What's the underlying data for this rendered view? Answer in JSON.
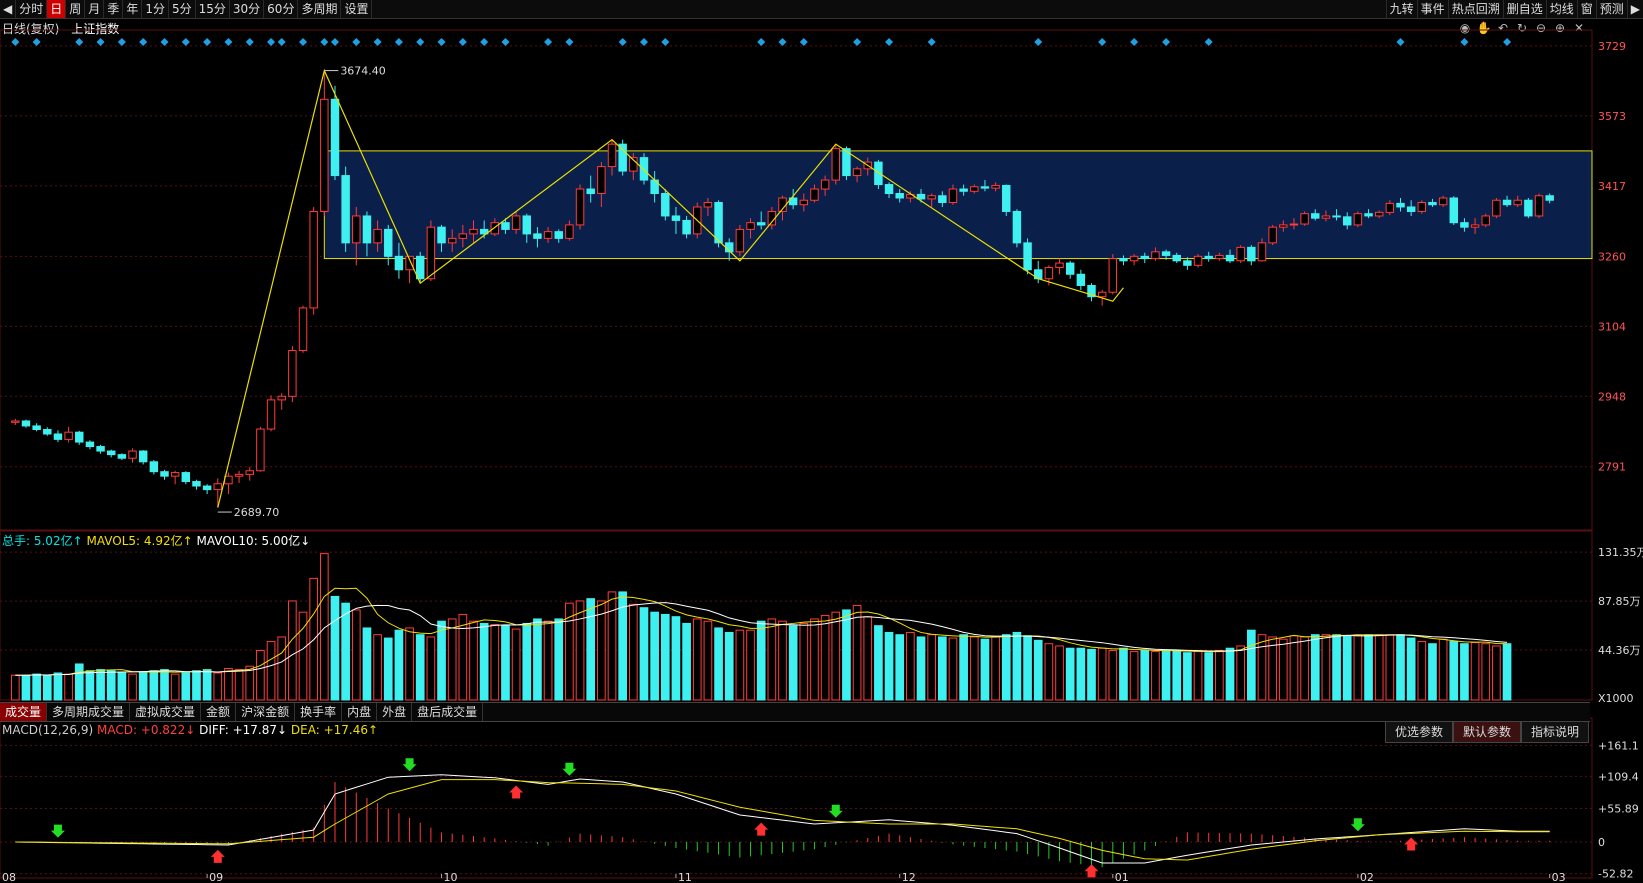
{
  "toolbar": {
    "left_items": [
      "分时",
      "日",
      "周",
      "月",
      "季",
      "年",
      "1分",
      "5分",
      "15分",
      "30分",
      "60分",
      "多周期",
      "设置"
    ],
    "active_index": 1,
    "right_items": [
      "九转",
      "事件",
      "热点回溯",
      "删自选",
      "均线",
      "窗",
      "预测"
    ]
  },
  "header": {
    "period": "日线(复权)",
    "index_name": "上证指数"
  },
  "price_axis": {
    "labels": [
      "3729",
      "3573",
      "3417",
      "3260",
      "3104",
      "2948",
      "2791"
    ]
  },
  "annotations": {
    "high_label": "3674.40",
    "low_label": "2689.70"
  },
  "volume": {
    "legend": [
      {
        "text": "总手: 5.02亿↑",
        "color": "#00e5e5"
      },
      {
        "text": "MAVOL5: 4.92亿↑",
        "color": "#f0e000"
      },
      {
        "text": "MAVOL10: 5.00亿↓",
        "color": "#ffffff"
      }
    ],
    "axis_labels": [
      "131.35万",
      "87.85万",
      "44.36万",
      "X1000"
    ]
  },
  "indicator_tabs": [
    "成交量",
    "多周期成交量",
    "虚拟成交量",
    "金额",
    "沪深金额",
    "换手率",
    "内盘",
    "外盘",
    "盘后成交量"
  ],
  "macd": {
    "legend": [
      {
        "text": "MACD(12,26,9)",
        "color": "#cccccc"
      },
      {
        "text": "MACD: +0.822↓",
        "color": "#ff4040"
      },
      {
        "text": "DIFF: +17.87↓",
        "color": "#ffffff"
      },
      {
        "text": "DEA: +17.46↑",
        "color": "#f0e000"
      }
    ],
    "axis_labels": [
      "+161.1",
      "+109.4",
      "+55.89",
      "0",
      "-52.82"
    ],
    "param_buttons": [
      "优选参数",
      "默认参数",
      "指标说明"
    ]
  },
  "date_axis": [
    "08",
    "09",
    "10",
    "11",
    "12",
    "01",
    "02",
    "03"
  ],
  "colors": {
    "up": "#ff3b3b",
    "down": "#3ff0f0",
    "box": "#0a1f4a",
    "line": "#e8e000"
  },
  "chart_data": {
    "type": "candlestick",
    "title": "上证指数",
    "price_range": [
      2650,
      3760
    ],
    "candles": [
      [
        2890,
        2898,
        2884,
        2893
      ],
      [
        2893,
        2896,
        2878,
        2882
      ],
      [
        2882,
        2888,
        2870,
        2874
      ],
      [
        2874,
        2879,
        2860,
        2864
      ],
      [
        2864,
        2872,
        2846,
        2852
      ],
      [
        2852,
        2880,
        2845,
        2868
      ],
      [
        2868,
        2871,
        2840,
        2846
      ],
      [
        2846,
        2850,
        2830,
        2836
      ],
      [
        2836,
        2840,
        2820,
        2826
      ],
      [
        2826,
        2829,
        2812,
        2818
      ],
      [
        2818,
        2821,
        2806,
        2810
      ],
      [
        2810,
        2832,
        2800,
        2826
      ],
      [
        2826,
        2828,
        2796,
        2802
      ],
      [
        2802,
        2806,
        2774,
        2780
      ],
      [
        2780,
        2784,
        2762,
        2770
      ],
      [
        2770,
        2782,
        2752,
        2778
      ],
      [
        2778,
        2781,
        2752,
        2758
      ],
      [
        2758,
        2762,
        2740,
        2748
      ],
      [
        2748,
        2752,
        2730,
        2740
      ],
      [
        2740,
        2765,
        2700,
        2753
      ],
      [
        2753,
        2778,
        2730,
        2770
      ],
      [
        2770,
        2782,
        2755,
        2774
      ],
      [
        2774,
        2790,
        2760,
        2782
      ],
      [
        2782,
        2880,
        2780,
        2875
      ],
      [
        2875,
        2950,
        2870,
        2940
      ],
      [
        2940,
        2955,
        2918,
        2948
      ],
      [
        2948,
        3060,
        2935,
        3050
      ],
      [
        3050,
        3150,
        3045,
        3145
      ],
      [
        3145,
        3370,
        3130,
        3360
      ],
      [
        3360,
        3674,
        3350,
        3610
      ],
      [
        3610,
        3640,
        3430,
        3440
      ],
      [
        3440,
        3460,
        3270,
        3290
      ],
      [
        3290,
        3370,
        3240,
        3350
      ],
      [
        3350,
        3360,
        3260,
        3290
      ],
      [
        3290,
        3340,
        3270,
        3320
      ],
      [
        3320,
        3330,
        3240,
        3260
      ],
      [
        3260,
        3290,
        3210,
        3230
      ],
      [
        3230,
        3260,
        3200,
        3260
      ],
      [
        3260,
        3270,
        3200,
        3210
      ],
      [
        3210,
        3340,
        3205,
        3325
      ],
      [
        3325,
        3330,
        3270,
        3290
      ],
      [
        3290,
        3320,
        3270,
        3300
      ],
      [
        3300,
        3330,
        3280,
        3310
      ],
      [
        3310,
        3340,
        3290,
        3320
      ],
      [
        3320,
        3340,
        3300,
        3310
      ],
      [
        3310,
        3345,
        3305,
        3335
      ],
      [
        3335,
        3345,
        3310,
        3320
      ],
      [
        3320,
        3360,
        3310,
        3350
      ],
      [
        3350,
        3355,
        3290,
        3310
      ],
      [
        3310,
        3325,
        3280,
        3300
      ],
      [
        3300,
        3325,
        3290,
        3315
      ],
      [
        3315,
        3320,
        3290,
        3300
      ],
      [
        3300,
        3340,
        3295,
        3330
      ],
      [
        3330,
        3420,
        3320,
        3410
      ],
      [
        3410,
        3440,
        3380,
        3400
      ],
      [
        3400,
        3470,
        3370,
        3460
      ],
      [
        3460,
        3520,
        3440,
        3510
      ],
      [
        3510,
        3520,
        3440,
        3450
      ],
      [
        3450,
        3490,
        3430,
        3480
      ],
      [
        3480,
        3490,
        3420,
        3430
      ],
      [
        3430,
        3450,
        3380,
        3400
      ],
      [
        3400,
        3410,
        3340,
        3350
      ],
      [
        3350,
        3370,
        3310,
        3340
      ],
      [
        3340,
        3350,
        3300,
        3310
      ],
      [
        3310,
        3380,
        3300,
        3370
      ],
      [
        3370,
        3390,
        3350,
        3380
      ],
      [
        3380,
        3385,
        3280,
        3290
      ],
      [
        3290,
        3300,
        3250,
        3270
      ],
      [
        3270,
        3330,
        3260,
        3320
      ],
      [
        3320,
        3345,
        3300,
        3335
      ],
      [
        3335,
        3360,
        3320,
        3330
      ],
      [
        3330,
        3370,
        3320,
        3360
      ],
      [
        3360,
        3395,
        3340,
        3390
      ],
      [
        3390,
        3410,
        3365,
        3375
      ],
      [
        3375,
        3400,
        3360,
        3385
      ],
      [
        3385,
        3420,
        3380,
        3410
      ],
      [
        3410,
        3440,
        3395,
        3430
      ],
      [
        3430,
        3510,
        3420,
        3500
      ],
      [
        3500,
        3505,
        3430,
        3440
      ],
      [
        3440,
        3460,
        3425,
        3455
      ],
      [
        3455,
        3480,
        3440,
        3470
      ],
      [
        3470,
        3475,
        3410,
        3420
      ],
      [
        3420,
        3425,
        3390,
        3400
      ],
      [
        3400,
        3410,
        3380,
        3390
      ],
      [
        3390,
        3405,
        3380,
        3398
      ],
      [
        3398,
        3410,
        3380,
        3388
      ],
      [
        3388,
        3400,
        3370,
        3395
      ],
      [
        3395,
        3405,
        3370,
        3380
      ],
      [
        3380,
        3420,
        3375,
        3410
      ],
      [
        3410,
        3420,
        3395,
        3405
      ],
      [
        3405,
        3420,
        3400,
        3415
      ],
      [
        3415,
        3430,
        3405,
        3412
      ],
      [
        3412,
        3425,
        3405,
        3418
      ],
      [
        3418,
        3420,
        3350,
        3360
      ],
      [
        3360,
        3365,
        3280,
        3290
      ],
      [
        3290,
        3300,
        3220,
        3230
      ],
      [
        3230,
        3250,
        3200,
        3210
      ],
      [
        3210,
        3240,
        3195,
        3235
      ],
      [
        3235,
        3255,
        3220,
        3245
      ],
      [
        3245,
        3250,
        3210,
        3220
      ],
      [
        3220,
        3230,
        3185,
        3195
      ],
      [
        3195,
        3200,
        3160,
        3170
      ],
      [
        3170,
        3185,
        3150,
        3180
      ],
      [
        3180,
        3265,
        3175,
        3255
      ],
      [
        3255,
        3262,
        3240,
        3250
      ],
      [
        3250,
        3265,
        3240,
        3260
      ],
      [
        3260,
        3268,
        3245,
        3255
      ],
      [
        3255,
        3280,
        3250,
        3270
      ],
      [
        3270,
        3275,
        3252,
        3262
      ],
      [
        3262,
        3268,
        3245,
        3250
      ],
      [
        3250,
        3258,
        3230,
        3240
      ],
      [
        3240,
        3265,
        3235,
        3260
      ],
      [
        3260,
        3270,
        3248,
        3255
      ],
      [
        3255,
        3268,
        3250,
        3262
      ],
      [
        3262,
        3275,
        3245,
        3250
      ],
      [
        3250,
        3285,
        3245,
        3280
      ],
      [
        3280,
        3285,
        3240,
        3250
      ],
      [
        3250,
        3300,
        3248,
        3290
      ],
      [
        3290,
        3330,
        3285,
        3325
      ],
      [
        3325,
        3340,
        3315,
        3330
      ],
      [
        3330,
        3345,
        3320,
        3332
      ],
      [
        3332,
        3360,
        3328,
        3355
      ],
      [
        3355,
        3365,
        3340,
        3345
      ],
      [
        3345,
        3362,
        3338,
        3350
      ],
      [
        3350,
        3365,
        3340,
        3348
      ],
      [
        3348,
        3358,
        3320,
        3330
      ],
      [
        3330,
        3360,
        3325,
        3355
      ],
      [
        3355,
        3365,
        3345,
        3350
      ],
      [
        3350,
        3362,
        3345,
        3358
      ],
      [
        3358,
        3385,
        3352,
        3378
      ],
      [
        3378,
        3390,
        3360,
        3370
      ],
      [
        3370,
        3385,
        3350,
        3360
      ],
      [
        3360,
        3385,
        3355,
        3380
      ],
      [
        3380,
        3388,
        3370,
        3375
      ],
      [
        3375,
        3395,
        3370,
        3390
      ],
      [
        3390,
        3394,
        3330,
        3335
      ],
      [
        3335,
        3345,
        3315,
        3325
      ],
      [
        3325,
        3345,
        3310,
        3330
      ],
      [
        3330,
        3355,
        3325,
        3350
      ],
      [
        3350,
        3390,
        3345,
        3385
      ],
      [
        3385,
        3395,
        3370,
        3375
      ],
      [
        3375,
        3395,
        3370,
        3385
      ],
      [
        3385,
        3390,
        3345,
        3350
      ],
      [
        3350,
        3400,
        3345,
        3395
      ],
      [
        3395,
        3400,
        3378,
        3385
      ]
    ],
    "volume": [
      22,
      22,
      23,
      22,
      24,
      23,
      32,
      26,
      27,
      26,
      24,
      23,
      25,
      26,
      27,
      23,
      24,
      26,
      27,
      24,
      28,
      27,
      30,
      44,
      52,
      56,
      88,
      78,
      108,
      130,
      92,
      86,
      80,
      64,
      58,
      55,
      62,
      64,
      58,
      56,
      70,
      72,
      76,
      70,
      68,
      67,
      66,
      63,
      68,
      72,
      70,
      72,
      86,
      88,
      90,
      88,
      96,
      96,
      85,
      82,
      78,
      76,
      74,
      68,
      72,
      70,
      64,
      60,
      62,
      62,
      70,
      72,
      70,
      66,
      68,
      72,
      75,
      78,
      80,
      84,
      74,
      66,
      60,
      58,
      60,
      56,
      58,
      56,
      55,
      58,
      56,
      54,
      56,
      58,
      60,
      57,
      53,
      50,
      48,
      46,
      46,
      45,
      46,
      44,
      46,
      43,
      44,
      43,
      44,
      44,
      42,
      43,
      42,
      44,
      46,
      48,
      62,
      58,
      56,
      54,
      57,
      56,
      58,
      58,
      58,
      57,
      58,
      58,
      58,
      58,
      58,
      55,
      52,
      50,
      54,
      52,
      50,
      51,
      50,
      48,
      50
    ],
    "macd_lines": {
      "dif": [
        [
          0,
          0
        ],
        [
          20,
          -5
        ],
        [
          28,
          20
        ],
        [
          30,
          80
        ],
        [
          35,
          108
        ],
        [
          40,
          112
        ],
        [
          45,
          107
        ],
        [
          50,
          96
        ],
        [
          53,
          105
        ],
        [
          57,
          100
        ],
        [
          62,
          80
        ],
        [
          68,
          45
        ],
        [
          75,
          30
        ],
        [
          82,
          37
        ],
        [
          88,
          28
        ],
        [
          94,
          14
        ],
        [
          98,
          -10
        ],
        [
          102,
          -35
        ],
        [
          106,
          -35
        ],
        [
          110,
          -22
        ],
        [
          116,
          -5
        ],
        [
          122,
          5
        ],
        [
          128,
          12
        ],
        [
          136,
          22
        ],
        [
          141,
          18
        ]
      ],
      "dea": [
        [
          0,
          0
        ],
        [
          20,
          -3
        ],
        [
          28,
          8
        ],
        [
          30,
          30
        ],
        [
          35,
          80
        ],
        [
          40,
          104
        ],
        [
          45,
          104
        ],
        [
          50,
          99
        ],
        [
          53,
          98
        ],
        [
          57,
          96
        ],
        [
          62,
          85
        ],
        [
          68,
          58
        ],
        [
          75,
          36
        ],
        [
          82,
          30
        ],
        [
          88,
          30
        ],
        [
          94,
          22
        ],
        [
          98,
          6
        ],
        [
          102,
          -14
        ],
        [
          106,
          -28
        ],
        [
          110,
          -30
        ],
        [
          116,
          -12
        ],
        [
          122,
          2
        ],
        [
          128,
          12
        ],
        [
          136,
          18
        ],
        [
          141,
          17
        ]
      ]
    }
  }
}
